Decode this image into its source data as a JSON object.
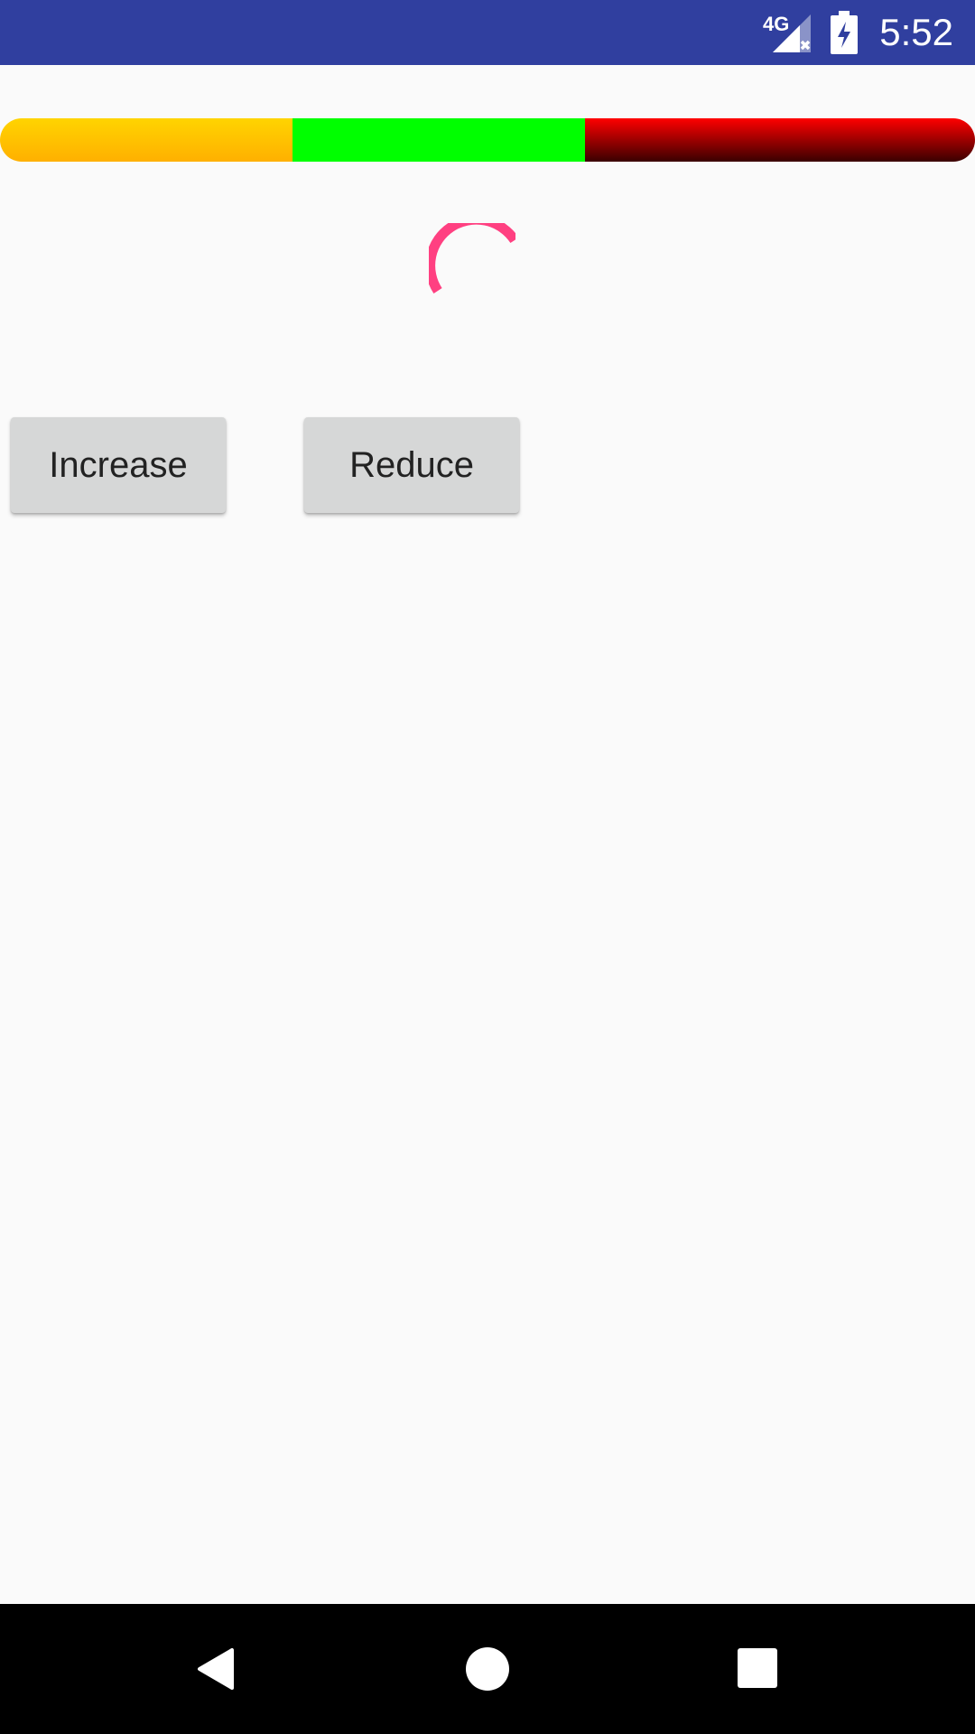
{
  "status_bar": {
    "network_label": "4G",
    "time": "5:52",
    "icons": [
      "signal-icon",
      "battery-charging-icon"
    ]
  },
  "progress_bar": {
    "segments": [
      {
        "name": "yellow",
        "fraction": 0.3,
        "color_top": "#ffd400",
        "color_bottom": "#ffb000"
      },
      {
        "name": "green",
        "fraction": 0.3,
        "color_top": "#00ff00",
        "color_bottom": "#00ff00"
      },
      {
        "name": "red",
        "fraction": 0.4,
        "color_top": "#ff0000",
        "color_bottom": "#3a0000"
      }
    ]
  },
  "spinner": {
    "color": "#ff4081",
    "icon": "loading-spinner-icon"
  },
  "buttons": {
    "increase_label": "Increase",
    "reduce_label": "Reduce"
  },
  "nav_bar": {
    "icons": [
      "back-icon",
      "home-icon",
      "recents-icon"
    ]
  },
  "colors": {
    "status_bar": "#303f9f",
    "background": "#fafafa",
    "button": "#d6d7d7",
    "nav_bar": "#000000"
  }
}
